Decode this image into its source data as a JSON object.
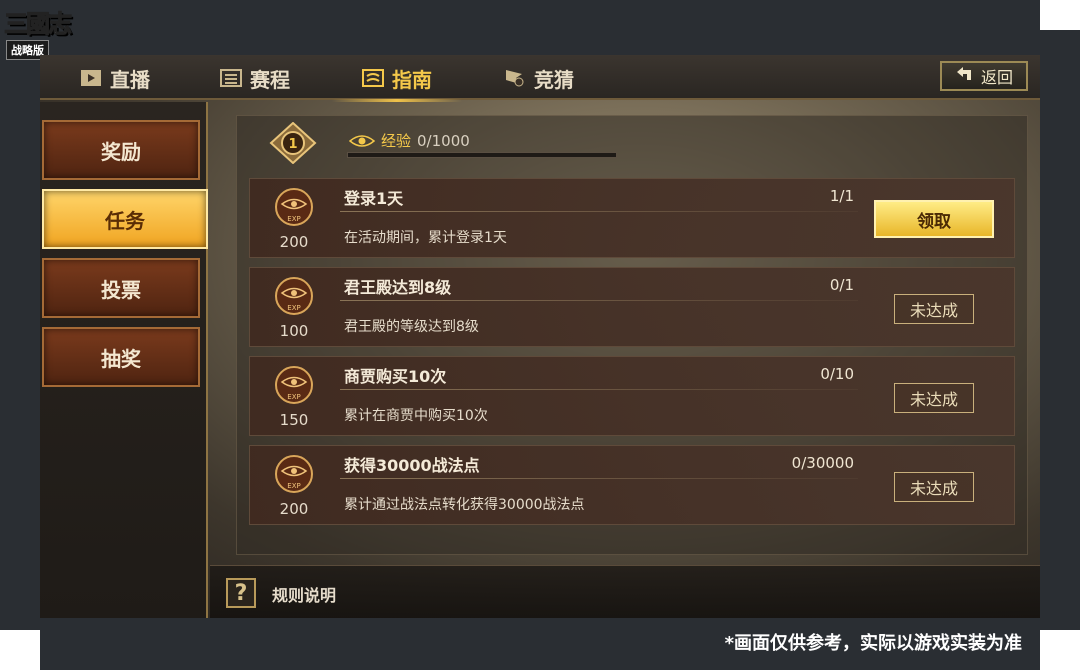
{
  "logo": {
    "title": "三國志",
    "subtitle": "战略版"
  },
  "tabs": [
    {
      "label": "直播",
      "icon": "tv-play-icon"
    },
    {
      "label": "赛程",
      "icon": "schedule-list-icon"
    },
    {
      "label": "指南",
      "icon": "guide-book-icon"
    },
    {
      "label": "竞猜",
      "icon": "flag-bet-icon"
    }
  ],
  "active_tab": "指南",
  "back_label": "返回",
  "sidebar": {
    "items": [
      {
        "label": "奖励"
      },
      {
        "label": "任务"
      },
      {
        "label": "投票"
      },
      {
        "label": "抽奖"
      }
    ],
    "active": "任务"
  },
  "exp": {
    "level": "1",
    "label": "经验",
    "value": "0/1000",
    "progress": 0
  },
  "tasks": [
    {
      "title": "登录1天",
      "progress": "1/1",
      "desc": "在活动期间，累计登录1天",
      "reward": "200",
      "status": "领取"
    },
    {
      "title": "君王殿达到8级",
      "progress": "0/1",
      "desc": "君王殿的等级达到8级",
      "reward": "100",
      "status": "未达成"
    },
    {
      "title": "商贾购买10次",
      "progress": "0/10",
      "desc": "累计在商贾中购买10次",
      "reward": "150",
      "status": "未达成"
    },
    {
      "title": "获得30000战法点",
      "progress": "0/30000",
      "desc": "累计通过战法点转化获得30000战法点",
      "reward": "200",
      "status": "未达成"
    }
  ],
  "rules_label": "规则说明",
  "disclaimer": "*画面仅供参考，实际以游戏实装为准",
  "colors": {
    "accent_gold": "#f4c84a",
    "active_sidebar": "#f0a421",
    "inactive_sidebar": "#6a3219"
  }
}
